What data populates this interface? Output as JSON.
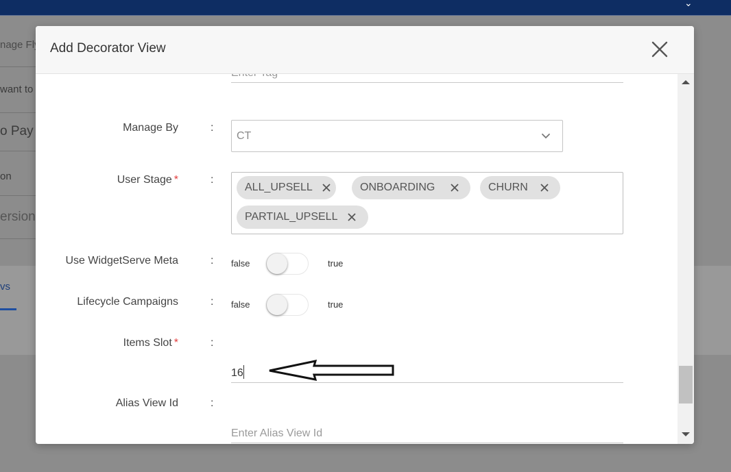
{
  "background": {
    "rows": [
      {
        "text": "nage Fly"
      },
      {
        "text": "want to"
      },
      {
        "text": "o Pay"
      },
      {
        "text": "on"
      },
      {
        "text": "ersion"
      }
    ],
    "tab_label": "vs"
  },
  "modal": {
    "title": "Add Decorator View",
    "fields": {
      "tag": {
        "placeholder": "Enter Tag"
      },
      "manage_by": {
        "label": "Manage By",
        "value": "CT"
      },
      "user_stage": {
        "label": "User Stage",
        "required_mark": "*",
        "chips": [
          {
            "label": "ALL_UPSELL"
          },
          {
            "label": "ONBOARDING"
          },
          {
            "label": "CHURN"
          },
          {
            "label": "PARTIAL_UPSELL"
          }
        ]
      },
      "use_widgetserve_meta": {
        "label": "Use WidgetServe Meta",
        "false_label": "false",
        "true_label": "true",
        "value": false
      },
      "lifecycle_campaigns": {
        "label": "Lifecycle Campaigns",
        "false_label": "false",
        "true_label": "true",
        "value": false
      },
      "items_slot": {
        "label": "Items Slot",
        "required_mark": "*",
        "value": "16"
      },
      "alias_view_id": {
        "label": "Alias View Id",
        "placeholder": "Enter Alias View Id"
      }
    },
    "colon": ":"
  },
  "icons": {
    "close": "close-icon",
    "chevron": "chevron-down-icon",
    "chip_remove": "close-icon",
    "annotation": "arrow-left-icon"
  },
  "colors": {
    "topbar": "#0e2d63",
    "required": "#e23c3c",
    "chip_bg": "#e1e1e1"
  }
}
